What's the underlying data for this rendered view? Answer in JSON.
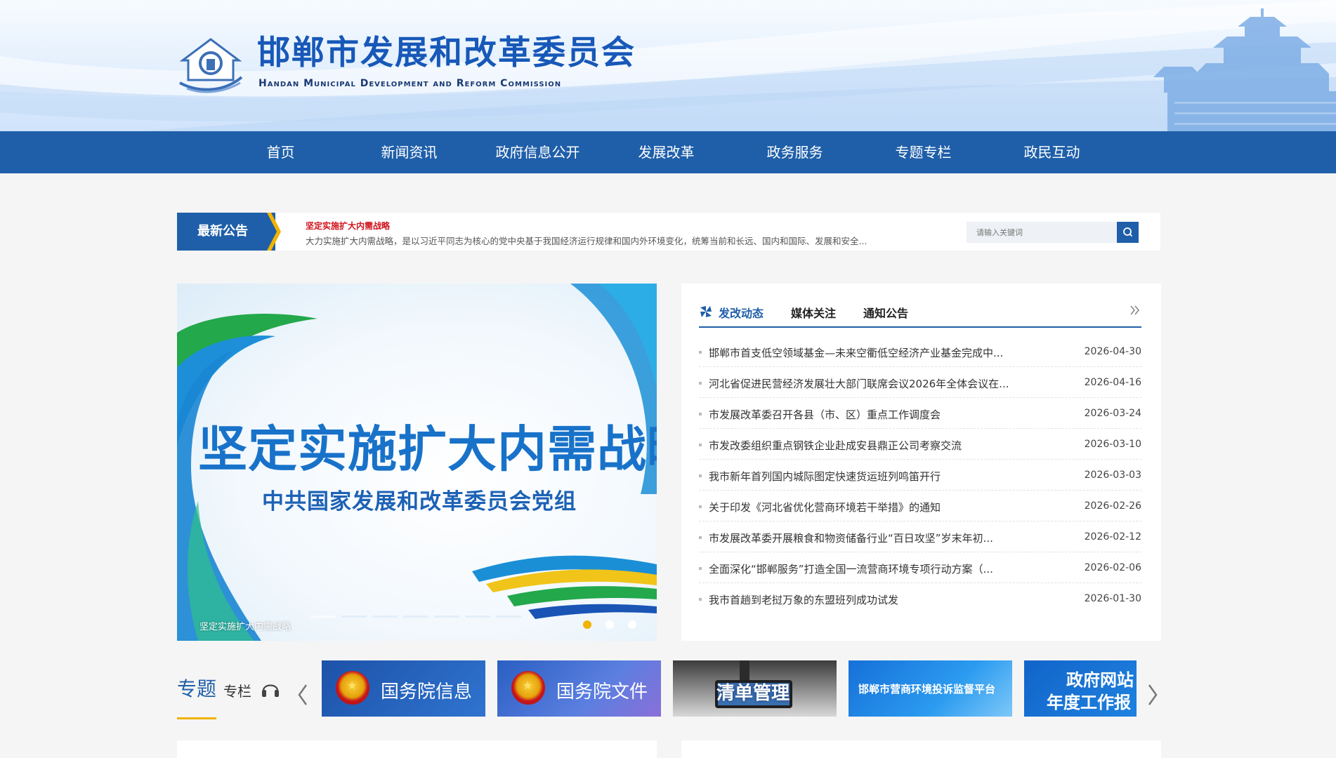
{
  "header": {
    "title": "邯郸市发展和改革委员会",
    "subtitle": "Handan Municipal Development and Reform Commission"
  },
  "nav": {
    "items": [
      "首页",
      "新闻资讯",
      "政府信息公开",
      "发展改革",
      "政务服务",
      "专题专栏",
      "政民互动"
    ]
  },
  "notice": {
    "tag": "最新公告",
    "title": "坚定实施扩大内需战略",
    "text": "大力实施扩大内需战略，是以习近平同志为核心的党中央基于我国经济运行规律和国内外环境变化，统筹当前和长远、国内和国际、发展和安全...",
    "search_placeholder": "请输入关键词"
  },
  "carousel": {
    "title": "坚定实施扩大内需战略",
    "subtitle": "中共国家发展和改革委员会党组",
    "caption": "坚定实施扩大内需战略",
    "active_slide": 1,
    "slide_count": 3
  },
  "news": {
    "tabs": [
      "发改动态",
      "媒体关注",
      "通知公告"
    ],
    "items": [
      {
        "title": "邯郸市首支低空领域基金—未来空衢低空经济产业基金完成中...",
        "date": "2026-04-30"
      },
      {
        "title": "河北省促进民营经济发展壮大部门联席会议2026年全体会议在...",
        "date": "2026-04-16"
      },
      {
        "title": "市发展改革委召开各县（市、区）重点工作调度会",
        "date": "2026-03-24"
      },
      {
        "title": "市发改委组织重点钢铁企业赴成安县鼎正公司考察交流",
        "date": "2026-03-10"
      },
      {
        "title": "我市新年首列国内城际图定快速货运班列鸣笛开行",
        "date": "2026-03-03"
      },
      {
        "title": "关于印发《河北省优化营商环境若干举措》的通知",
        "date": "2026-02-26"
      },
      {
        "title": "市发展改革委开展粮食和物资储备行业“百日攻坚”岁末年初...",
        "date": "2026-02-12"
      },
      {
        "title": "全面深化“邯郸服务”打造全国一流营商环境专项行动方案（...",
        "date": "2026-02-06"
      },
      {
        "title": "我市首趟到老挝万象的东盟班列成功试发",
        "date": "2026-01-30"
      }
    ]
  },
  "special": {
    "heading_big": "专题",
    "heading_small": "专栏",
    "tiles": [
      {
        "label": "国务院信息"
      },
      {
        "label": "国务院文件"
      },
      {
        "label": "清单管理"
      },
      {
        "label": "邯郸市营商环境投诉监督平台"
      },
      {
        "label": "政府网站",
        "label2": "年度工作报"
      }
    ]
  },
  "colors": {
    "primary": "#1f5fa9",
    "accent": "#f0b300",
    "notice_red": "#d0121b"
  }
}
